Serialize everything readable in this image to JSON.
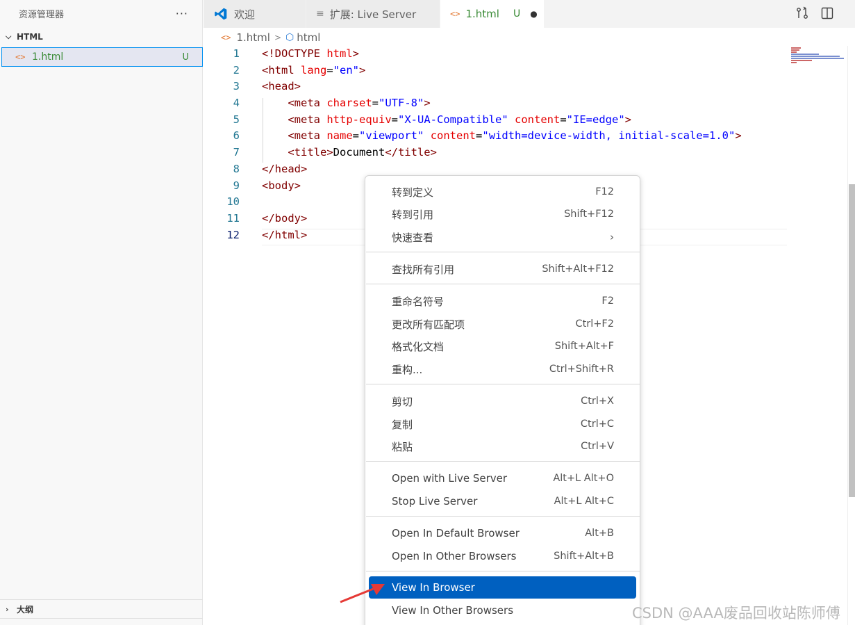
{
  "sidebar": {
    "title": "资源管理器",
    "more": "···",
    "folder": "HTML",
    "file": {
      "name": "1.html",
      "status": "U"
    },
    "outline": "大纲"
  },
  "tabs": [
    {
      "label": "欢迎"
    },
    {
      "label": "扩展: Live Server"
    },
    {
      "label": "1.html",
      "status": "U",
      "modified": "●"
    }
  ],
  "breadcrumb": {
    "file": "1.html",
    "symbol": "html"
  },
  "editor": {
    "line_numbers": [
      "1",
      "2",
      "3",
      "4",
      "5",
      "6",
      "7",
      "8",
      "9",
      "10",
      "11",
      "12"
    ]
  },
  "context_menu": {
    "items": [
      {
        "label": "转到定义",
        "shortcut": "F12"
      },
      {
        "label": "转到引用",
        "shortcut": "Shift+F12"
      },
      {
        "label": "快速查看",
        "shortcut": ""
      },
      {
        "label": "查找所有引用",
        "shortcut": "Shift+Alt+F12"
      },
      {
        "label": "重命名符号",
        "shortcut": "F2"
      },
      {
        "label": "更改所有匹配项",
        "shortcut": "Ctrl+F2"
      },
      {
        "label": "格式化文档",
        "shortcut": "Shift+Alt+F"
      },
      {
        "label": "重构...",
        "shortcut": "Ctrl+Shift+R"
      },
      {
        "label": "剪切",
        "shortcut": "Ctrl+X"
      },
      {
        "label": "复制",
        "shortcut": "Ctrl+C"
      },
      {
        "label": "粘贴",
        "shortcut": "Ctrl+V"
      },
      {
        "label": "Open with Live Server",
        "shortcut": "Alt+L Alt+O"
      },
      {
        "label": "Stop Live Server",
        "shortcut": "Alt+L Alt+C"
      },
      {
        "label": "Open In Default Browser",
        "shortcut": "Alt+B"
      },
      {
        "label": "Open In Other Browsers",
        "shortcut": "Shift+Alt+B"
      },
      {
        "label": "View In Browser",
        "shortcut": ""
      },
      {
        "label": "View In Other Browsers",
        "shortcut": ""
      }
    ],
    "selected": "View In Browser"
  },
  "watermark": "CSDN @AAA废品回收站陈师傅",
  "colors": {
    "accent": "#0060c0",
    "git_untracked": "#388a34",
    "arrow": "#e53935"
  }
}
